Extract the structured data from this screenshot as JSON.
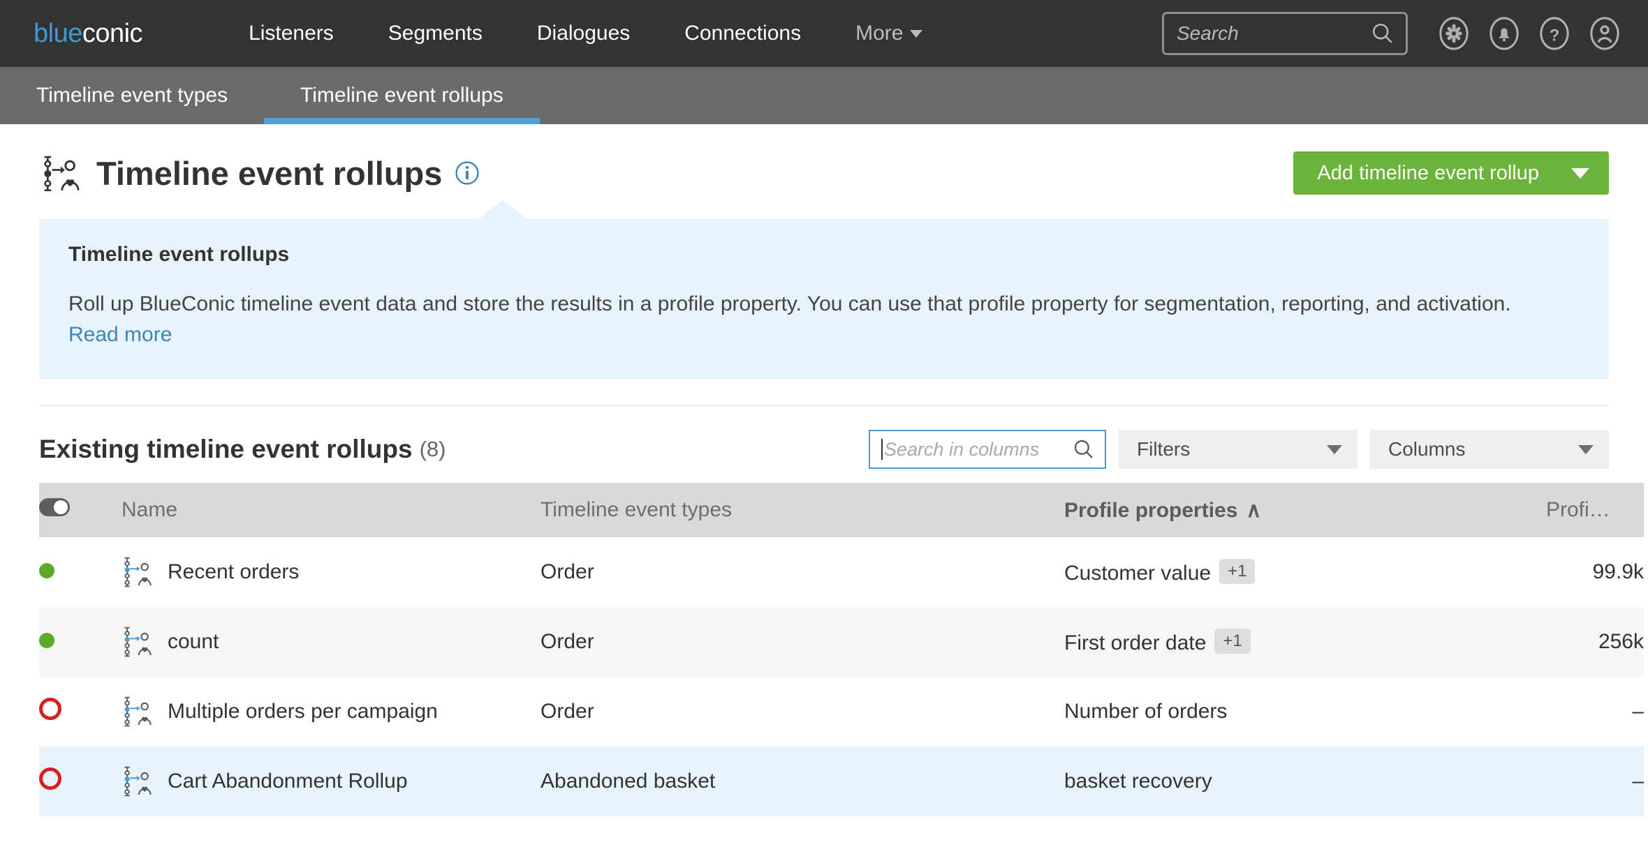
{
  "brand": {
    "name_part1": "blue",
    "name_part2": "conic"
  },
  "topnav": {
    "links": [
      {
        "label": "Listeners"
      },
      {
        "label": "Segments"
      },
      {
        "label": "Dialogues"
      },
      {
        "label": "Connections"
      }
    ],
    "more_label": "More",
    "search_placeholder": "Search",
    "icons": [
      "gear-icon",
      "bell-icon",
      "help-icon",
      "account-icon"
    ]
  },
  "tabs": [
    {
      "label": "Timeline event types",
      "active": false
    },
    {
      "label": "Timeline event rollups",
      "active": true
    }
  ],
  "header": {
    "title": "Timeline event rollups",
    "add_button_label": "Add timeline event rollup"
  },
  "banner": {
    "heading": "Timeline event rollups",
    "body": "Roll up BlueConic timeline event data and store the results in a profile property. You can use that profile property for segmentation, reporting, and activation.",
    "link_label": "Read more"
  },
  "list": {
    "title": "Existing timeline event rollups",
    "count": "(8)",
    "search_placeholder": "Search in columns",
    "filters_label": "Filters",
    "columns_label": "Columns"
  },
  "table": {
    "headers": {
      "name": "Name",
      "types": "Timeline event types",
      "properties": "Profile properties",
      "profiles": "Profi…"
    },
    "sort_indicator": "∧",
    "rows": [
      {
        "status": "on",
        "name": "Recent orders",
        "types": "Order",
        "properties": "Customer value",
        "properties_badge": "+1",
        "profiles": "99.9k"
      },
      {
        "status": "on",
        "name": "count",
        "types": "Order",
        "properties": "First order date",
        "properties_badge": "+1",
        "profiles": "256k"
      },
      {
        "status": "off",
        "name": "Multiple orders per campaign",
        "types": "Order",
        "properties": "Number of orders",
        "properties_badge": "",
        "profiles": "–"
      },
      {
        "status": "off",
        "name": "Cart Abandonment Rollup",
        "types": "Abandoned basket",
        "properties": "basket recovery",
        "properties_badge": "",
        "profiles": "–"
      }
    ]
  },
  "colors": {
    "nav_background": "#333333",
    "tabbar_background": "#6b6b6b",
    "tab_active_underline": "#4fa3d8",
    "brand_blue": "#3d9bd4",
    "primary_green": "#6bb33a",
    "banner_background": "#e8f4fb",
    "status_on": "#5caa28",
    "status_off": "#d81f1f",
    "row_selected": "#e8f4fb"
  }
}
